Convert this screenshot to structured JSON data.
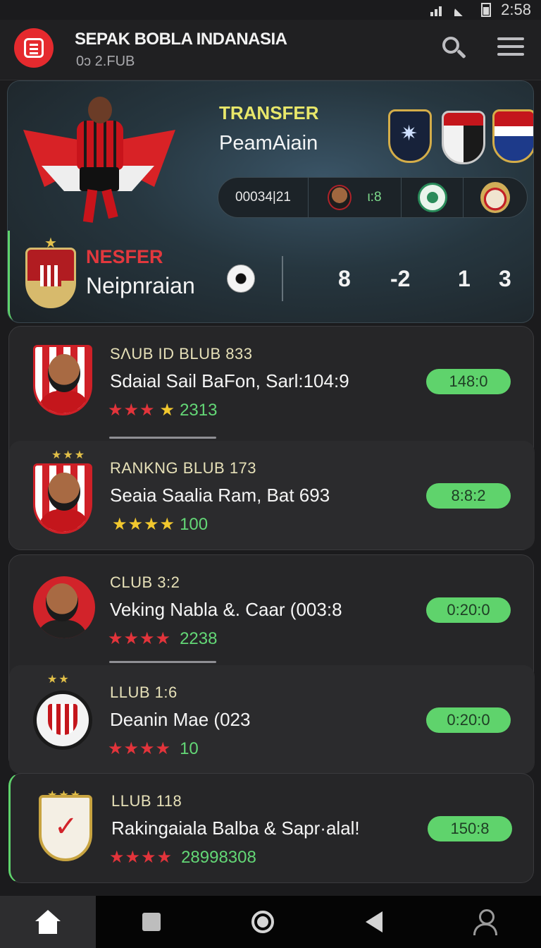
{
  "status_bar": {
    "time": "2:58"
  },
  "app": {
    "title": "SEPAK BOBLA INDANASIA",
    "subtitle": "0ɔ 2.FUB"
  },
  "hero": {
    "label": "TRANSFER",
    "name": "PeamAiain",
    "stat_code": "00034|21",
    "stat_value": "ι:8",
    "lower_label": "NESFER",
    "lower_name": "Neipnraian",
    "scores": [
      "8",
      "-2",
      "1",
      "3"
    ]
  },
  "list": [
    {
      "label": "SΛUB ID BLUB  833",
      "title": "Sdaial Sail BaFon, Sarl:104:9",
      "stars_red": "★★★",
      "stars_gold": "★",
      "rating": "2313",
      "pill": "148:0",
      "avatar": "player-crest"
    },
    {
      "label": "RANKNG BLUB  173",
      "title": "Seaia Saalia Ram, Bat 693",
      "stars_red": "",
      "stars_gold": "★★★★",
      "rating": "100",
      "pill": "8:8:2",
      "avatar": "player-crest"
    },
    {
      "label": "CLUB 3:2",
      "title": "Veking Nabla &. Caar (003:8",
      "stars_red": "★★★★",
      "stars_gold": "",
      "rating": "2238",
      "pill": "0:20:0",
      "avatar": "player-circle"
    },
    {
      "label": "LLUB 1:6",
      "title": "Deanin Mae (023",
      "stars_red": "★★★★",
      "stars_gold": "",
      "rating": "10",
      "pill": "0:20:0",
      "avatar": "club-badge"
    },
    {
      "label": "LLUB 118",
      "title": "Rakingaiala Balba & Sapr·alal!",
      "stars_red": "★★★★",
      "stars_gold": "",
      "rating": "28998308",
      "pill": "150:8",
      "avatar": "club-shield"
    }
  ],
  "nav": [
    "home-icon",
    "square-icon",
    "circle-icon",
    "back-icon",
    "user-icon"
  ],
  "colors": {
    "accent_green": "#5fd36c",
    "accent_red": "#e52a2e",
    "label_yellow": "#e8e76a",
    "background": "#1b1b1d"
  }
}
